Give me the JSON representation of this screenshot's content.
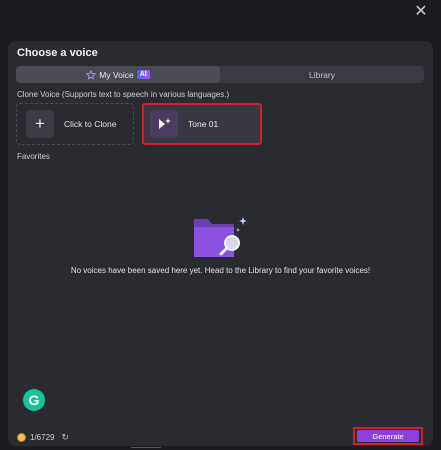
{
  "window": {
    "close_symbol": "✕"
  },
  "panel": {
    "title": "Choose a voice",
    "tabs": [
      {
        "label": "My Voice",
        "badge": "AI",
        "active": true,
        "icon": "star-icon"
      },
      {
        "label": "Library",
        "active": false
      }
    ],
    "clone_section_label": "Clone Voice (Supports text to speech in various languages.)",
    "clone_card": {
      "symbol": "+",
      "label": "Click to Clone"
    },
    "tone_card": {
      "label": "Tone 01",
      "icon": "voice-spark-icon"
    },
    "favorites_label": "Favorites",
    "empty_message": "No voices have been saved here yet. Head to the Library to find your favorite voices!",
    "grammarly_letter": "G",
    "credits": {
      "value": "1/6729",
      "refresh_symbol": "↻"
    },
    "generate_label": "Generate"
  },
  "colors": {
    "accent": "#8e3fe0",
    "highlight_border": "#d01f2e",
    "panel_bg": "#2a2b31",
    "page_bg": "#1b1c20"
  }
}
